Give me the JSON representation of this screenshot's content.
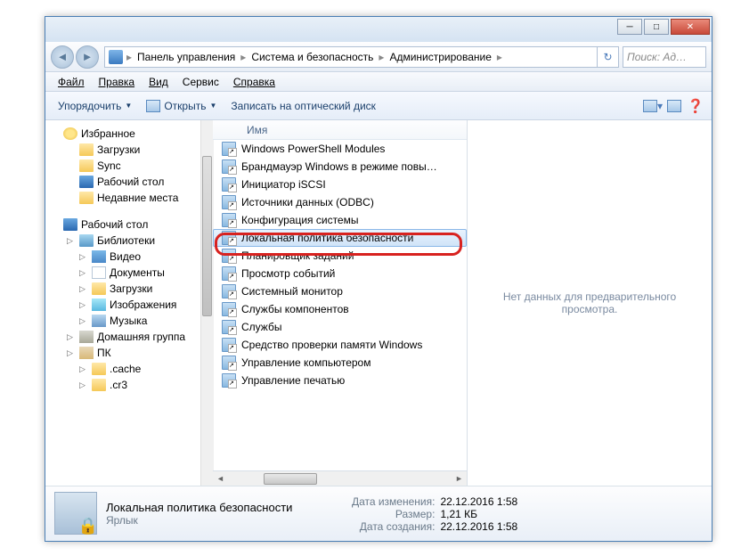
{
  "breadcrumb": {
    "seg1": "Панель управления",
    "seg2": "Система и безопасность",
    "seg3": "Администрирование"
  },
  "search_placeholder": "Поиск: Ад…",
  "menu": {
    "file": "Файл",
    "edit": "Правка",
    "view": "Вид",
    "tools": "Сервис",
    "help": "Справка"
  },
  "toolbar": {
    "organize": "Упорядочить",
    "open": "Открыть",
    "burn": "Записать на оптический диск"
  },
  "column_name": "Имя",
  "tree": {
    "favorites": "Избранное",
    "downloads": "Загрузки",
    "sync": "Sync",
    "desktop1": "Рабочий стол",
    "recent": "Недавние места",
    "desktop2": "Рабочий стол",
    "libraries": "Библиотеки",
    "video": "Видео",
    "documents": "Документы",
    "downloads2": "Загрузки",
    "pictures": "Изображения",
    "music": "Музыка",
    "homegroup": "Домашняя группа",
    "pc": "ПК",
    "cache": ".cache",
    "cr3": ".cr3"
  },
  "files": [
    "Windows PowerShell Modules",
    "Брандмауэр Windows в режиме повы…",
    "Инициатор iSCSI",
    "Источники данных (ODBC)",
    "Конфигурация системы",
    "Локальная политика безопасности",
    "Планировщик заданий",
    "Просмотр событий",
    "Системный монитор",
    "Службы компонентов",
    "Службы",
    "Средство проверки памяти Windows",
    "Управление компьютером",
    "Управление печатью"
  ],
  "selected_index": 5,
  "preview_text": "Нет данных для предварительного просмотра.",
  "details": {
    "name": "Локальная политика безопасности",
    "type": "Ярлык",
    "mod_label": "Дата изменения:",
    "mod_value": "22.12.2016 1:58",
    "size_label": "Размер:",
    "size_value": "1,21 КБ",
    "created_label": "Дата создания:",
    "created_value": "22.12.2016 1:58"
  }
}
